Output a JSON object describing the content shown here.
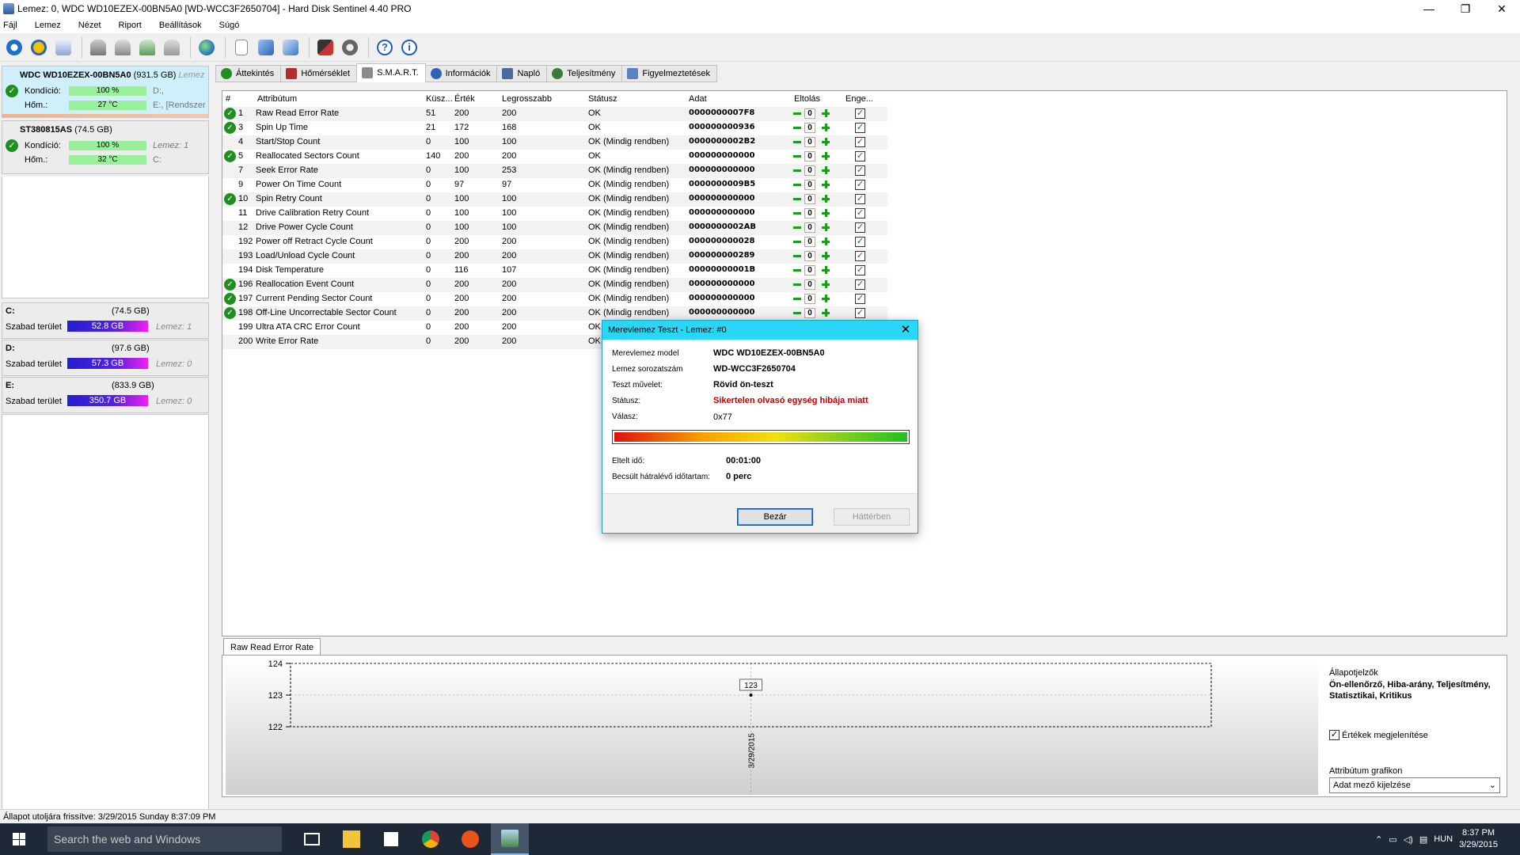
{
  "window": {
    "title": "Lemez: 0, WDC WD10EZEX-00BN5A0 [WD-WCC3F2650704] - Hard Disk Sentinel 4.40 PRO",
    "minimize": "—",
    "maximize": "❐",
    "close": "✕"
  },
  "menu": [
    "Fájl",
    "Lemez",
    "Nézet",
    "Riport",
    "Beállítások",
    "Súgó"
  ],
  "toolbar_icons": [
    "refresh-icon",
    "warning-icon",
    "disk-icon",
    "tool1-icon",
    "tool2-icon",
    "tool3-icon",
    "tool4-icon",
    "globe-icon",
    "report-icon",
    "sync-icon",
    "network-icon",
    "chart-icon",
    "settings-icon",
    "help-icon",
    "info-icon"
  ],
  "disks": [
    {
      "name": "WDC WD10EZEX-00BN5A0",
      "size": "(931.5 GB)",
      "extra": "Lemez",
      "health_label": "Kondíció:",
      "health": "100 %",
      "health_side": "D:,",
      "temp_label": "Hőm.:",
      "temp": "27 °C",
      "temp_side": "E:, [Rendszer"
    },
    {
      "name": "ST380815AS",
      "size": "(74.5 GB)",
      "health_label": "Kondíció:",
      "health": "100 %",
      "health_side": "Lemez: 1",
      "temp_label": "Hőm.:",
      "temp": "32 °C",
      "temp_side": "C:"
    }
  ],
  "volumes": [
    {
      "letter": "C:",
      "size": "(74.5 GB)",
      "free_label": "Szabad terület",
      "free": "52.8 GB",
      "disk": "Lemez: 1"
    },
    {
      "letter": "D:",
      "size": "(97.6 GB)",
      "free_label": "Szabad terület",
      "free": "57.3 GB",
      "disk": "Lemez: 0"
    },
    {
      "letter": "E:",
      "size": "(833.9 GB)",
      "free_label": "Szabad terület",
      "free": "350.7 GB",
      "disk": "Lemez: 0"
    }
  ],
  "tabs": [
    {
      "label": "Áttekintés",
      "color": "#1f8f1f"
    },
    {
      "label": "Hőmérséklet",
      "color": "#b03030"
    },
    {
      "label": "S.M.A.R.T.",
      "color": "#8a8a8a"
    },
    {
      "label": "Információk",
      "color": "#2c62b8"
    },
    {
      "label": "Napló",
      "color": "#4a6c9c"
    },
    {
      "label": "Teljesítmény",
      "color": "#3a7a3a"
    },
    {
      "label": "Figyelmeztetések",
      "color": "#5a82c0"
    }
  ],
  "smart": {
    "headers": [
      "#",
      "Attribútum",
      "Küsz...",
      "Érték",
      "Legrosszabb",
      "Státusz",
      "Adat",
      "Eltolás",
      "Enge..."
    ],
    "rows": [
      {
        "ok": true,
        "id": "1",
        "name": "Raw Read Error Rate",
        "thr": "51",
        "val": "200",
        "worst": "200",
        "status": "OK",
        "data": "0000000007F8",
        "offset": "0"
      },
      {
        "ok": true,
        "id": "3",
        "name": "Spin Up Time",
        "thr": "21",
        "val": "172",
        "worst": "168",
        "status": "OK",
        "data": "000000000936",
        "offset": "0"
      },
      {
        "ok": false,
        "id": "4",
        "name": "Start/Stop Count",
        "thr": "0",
        "val": "100",
        "worst": "100",
        "status": "OK (Mindig rendben)",
        "data": "0000000002B2",
        "offset": "0"
      },
      {
        "ok": true,
        "id": "5",
        "name": "Reallocated Sectors Count",
        "thr": "140",
        "val": "200",
        "worst": "200",
        "status": "OK",
        "data": "000000000000",
        "offset": "0"
      },
      {
        "ok": false,
        "id": "7",
        "name": "Seek Error Rate",
        "thr": "0",
        "val": "100",
        "worst": "253",
        "status": "OK (Mindig rendben)",
        "data": "000000000000",
        "offset": "0"
      },
      {
        "ok": false,
        "id": "9",
        "name": "Power On Time Count",
        "thr": "0",
        "val": "97",
        "worst": "97",
        "status": "OK (Mindig rendben)",
        "data": "0000000009B5",
        "offset": "0"
      },
      {
        "ok": true,
        "id": "10",
        "name": "Spin Retry Count",
        "thr": "0",
        "val": "100",
        "worst": "100",
        "status": "OK (Mindig rendben)",
        "data": "000000000000",
        "offset": "0"
      },
      {
        "ok": false,
        "id": "11",
        "name": "Drive Calibration Retry Count",
        "thr": "0",
        "val": "100",
        "worst": "100",
        "status": "OK (Mindig rendben)",
        "data": "000000000000",
        "offset": "0"
      },
      {
        "ok": false,
        "id": "12",
        "name": "Drive Power Cycle Count",
        "thr": "0",
        "val": "100",
        "worst": "100",
        "status": "OK (Mindig rendben)",
        "data": "0000000002AB",
        "offset": "0"
      },
      {
        "ok": false,
        "id": "192",
        "name": "Power off Retract Cycle Count",
        "thr": "0",
        "val": "200",
        "worst": "200",
        "status": "OK (Mindig rendben)",
        "data": "000000000028",
        "offset": "0"
      },
      {
        "ok": false,
        "id": "193",
        "name": "Load/Unload Cycle Count",
        "thr": "0",
        "val": "200",
        "worst": "200",
        "status": "OK (Mindig rendben)",
        "data": "000000000289",
        "offset": "0"
      },
      {
        "ok": false,
        "id": "194",
        "name": "Disk Temperature",
        "thr": "0",
        "val": "116",
        "worst": "107",
        "status": "OK (Mindig rendben)",
        "data": "00000000001B",
        "offset": "0"
      },
      {
        "ok": true,
        "id": "196",
        "name": "Reallocation Event Count",
        "thr": "0",
        "val": "200",
        "worst": "200",
        "status": "OK (Mindig rendben)",
        "data": "000000000000",
        "offset": "0"
      },
      {
        "ok": true,
        "id": "197",
        "name": "Current Pending Sector Count",
        "thr": "0",
        "val": "200",
        "worst": "200",
        "status": "OK (Mindig rendben)",
        "data": "000000000000",
        "offset": "0"
      },
      {
        "ok": true,
        "id": "198",
        "name": "Off-Line Uncorrectable Sector Count",
        "thr": "0",
        "val": "200",
        "worst": "200",
        "status": "OK (Mindig rendben)",
        "data": "000000000000",
        "offset": "0"
      },
      {
        "ok": false,
        "id": "199",
        "name": "Ultra ATA CRC Error Count",
        "thr": "0",
        "val": "200",
        "worst": "200",
        "status": "OK",
        "data": "",
        "offset": null
      },
      {
        "ok": false,
        "id": "200",
        "name": "Write Error Rate",
        "thr": "0",
        "val": "200",
        "worst": "200",
        "status": "OK",
        "data": "",
        "offset": null
      }
    ]
  },
  "graph": {
    "tab_label": "Raw Read Error Rate",
    "side_heading": "Állapotjelzők",
    "side_bold": "Ön-ellenőrző, Hiba-arány, Teljesítmény, Statisztikai, Kritikus",
    "show_values_label": "Értékek megjelenítése",
    "attr_graph_label": "Attribútum grafikon",
    "attr_graph_select": "Adat mező kijelzése"
  },
  "chart_data": {
    "type": "line",
    "x": [
      "3/29/2015"
    ],
    "series": [
      {
        "values": [
          123
        ]
      }
    ],
    "ylim": [
      122,
      124
    ],
    "yticks": [
      "124",
      "123",
      "122"
    ],
    "point_label": "123",
    "grid": true
  },
  "dialog": {
    "title": "Merevlemez Teszt - Lemez: #0",
    "close": "✕",
    "model_label": "Merevlemez model",
    "model": "WDC WD10EZEX-00BN5A0",
    "serial_label": "Lemez sorozatszám",
    "serial": "WD-WCC3F2650704",
    "op_label": "Teszt művelet:",
    "op": "Rövid ön-teszt",
    "status_label": "Státusz:",
    "status": "Sikertelen olvasó egység hibája miatt",
    "answer_label": "Válasz:",
    "answer": "0x77",
    "progress": 1.0,
    "elapsed_label": "Eltelt idő:",
    "elapsed": "00:01:00",
    "remaining_label": "Becsült hátralévő időtartam:",
    "remaining": "0 perc",
    "close_button": "Bezár",
    "background_button": "Háttérben"
  },
  "statusbar": {
    "text": "Állapot utoljára frissítve: 3/29/2015 Sunday 8:37:09 PM"
  },
  "taskbar": {
    "search_placeholder": "Search the web and Windows",
    "lang": "HUN",
    "time": "8:37 PM",
    "date": "3/29/2015"
  }
}
